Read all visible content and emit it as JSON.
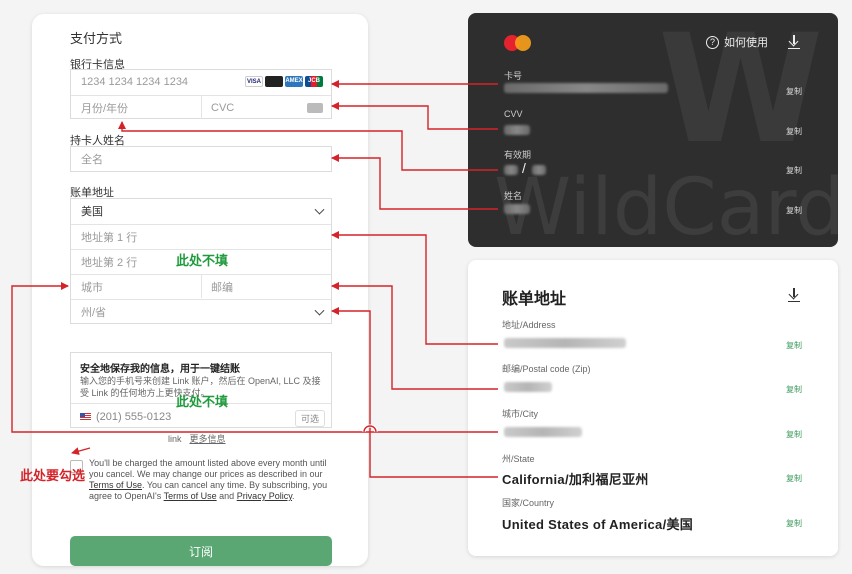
{
  "payment": {
    "title": "支付方式",
    "card_info_label": "银行卡信息",
    "card_number_placeholder": "1234 1234 1234 1234",
    "card_brands": [
      "VISA",
      "",
      "AMEX",
      "JCB"
    ],
    "expiry_placeholder": "月份/年份",
    "cvc_placeholder": "CVC",
    "holder_label": "持卡人姓名",
    "holder_placeholder": "全名",
    "billing_label": "账单地址",
    "country_value": "美国",
    "address1_placeholder": "地址第 1 行",
    "address2_placeholder": "地址第 2 行",
    "city_placeholder": "城市",
    "zip_placeholder": "邮编",
    "state_placeholder": "州/省",
    "link_title": "安全地保存我的信息，用于一键结账",
    "link_desc": "输入您的手机号来创建 Link 账户，然后在 OpenAI, LLC 及接受 Link 的任何地方上更快支付。",
    "phone_placeholder": "(201) 555-0123",
    "optional": "可选",
    "link_brand": "link",
    "more_info": "更多信息",
    "terms_text_1": "You'll be charged the amount listed above every month until you cancel. We may change our prices as described in our",
    "terms_link_1": "Terms of Use",
    "terms_text_2": ". You can cancel any time. By subscribing, you agree to OpenAI's",
    "terms_link_2": "Terms of Use",
    "terms_text_3": "and",
    "terms_link_3": "Privacy Policy",
    "terms_text_4": ".",
    "subscribe": "订阅"
  },
  "wildcard": {
    "brand_watermark": "WildCard",
    "howto": "如何使用",
    "card_number_label": "卡号",
    "cvv_label": "CVV",
    "expiry_label": "有效期",
    "name_label": "姓名",
    "copy": "复制",
    "slash": "/"
  },
  "billing": {
    "title": "账单地址",
    "address_label": "地址/Address",
    "zip_label": "邮编/Postal code (Zip)",
    "city_label": "城市/City",
    "state_label": "州/State",
    "state_value": "California/加利福尼亚州",
    "country_label": "国家/Country",
    "country_value": "United States of America/美国",
    "copy": "复制"
  },
  "annotations": {
    "skip_1": "此处不填",
    "skip_2": "此处不填",
    "must_check": "此处要勾选",
    "arrow_color": "#d3242a"
  }
}
